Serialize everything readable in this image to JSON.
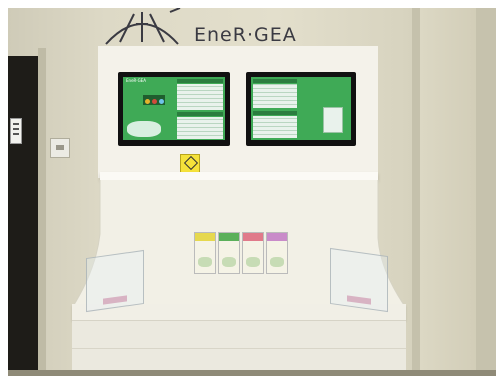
{
  "scene": {
    "description_tag": "",
    "logo": {
      "text": "EneR·GEA",
      "mark_icon": "windmill-logo-icon"
    },
    "colors": {
      "wall": "#e3dfcc",
      "kiosk": "#f4f2ea",
      "screen_green": "#3faa56",
      "screen_frame": "#111111",
      "door": "#1e1c18"
    },
    "screens": [
      {
        "name": "left-display",
        "title": "EneR·GEA"
      },
      {
        "name": "right-display",
        "title": ""
      }
    ],
    "brochures": [
      {
        "name": "brochure-yellow",
        "accent": "#e6d84e"
      },
      {
        "name": "brochure-green",
        "accent": "#5bb05a"
      },
      {
        "name": "brochure-pink",
        "accent": "#e07a8a"
      },
      {
        "name": "brochure-purple",
        "accent": "#c98bc9"
      }
    ]
  }
}
